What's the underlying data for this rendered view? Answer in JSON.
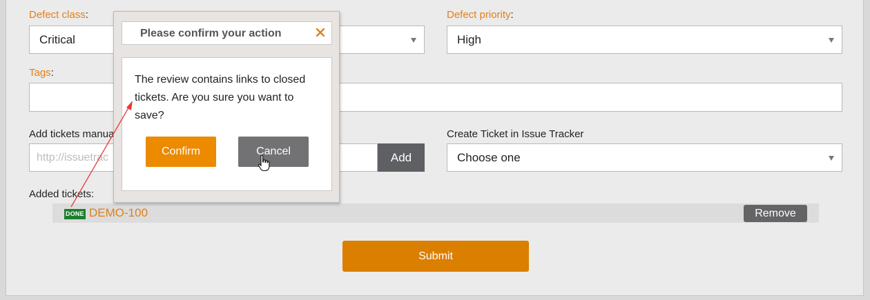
{
  "form": {
    "defect_class": {
      "label": "Defect class",
      "colon": ":",
      "value": "Critical"
    },
    "defect_priority": {
      "label": "Defect priority",
      "colon": ":",
      "value": "High"
    },
    "tags": {
      "label": "Tags",
      "colon": ":"
    },
    "add_tickets": {
      "label": "Add tickets manua",
      "placeholder": "http://issuetrac",
      "add_label": "Add"
    },
    "create_ticket": {
      "label": "Create Ticket in Issue Tracker",
      "value": "Choose one"
    },
    "added_tickets": {
      "label": "Added tickets:",
      "items": [
        {
          "badge": "DONE",
          "id": "DEMO-100",
          "remove_label": "Remove"
        }
      ]
    },
    "submit_label": "Submit"
  },
  "modal": {
    "title": "Please confirm your action",
    "message": "The review contains links to closed tickets. Are you sure you want to save?",
    "confirm_label": "Confirm",
    "cancel_label": "Cancel"
  },
  "colors": {
    "accent_orange": "#e0801b",
    "button_orange": "#db7f00",
    "button_gray": "#6f6f6f",
    "done_green": "#1c7e2d",
    "annotation_arrow": "#e53b3b"
  }
}
